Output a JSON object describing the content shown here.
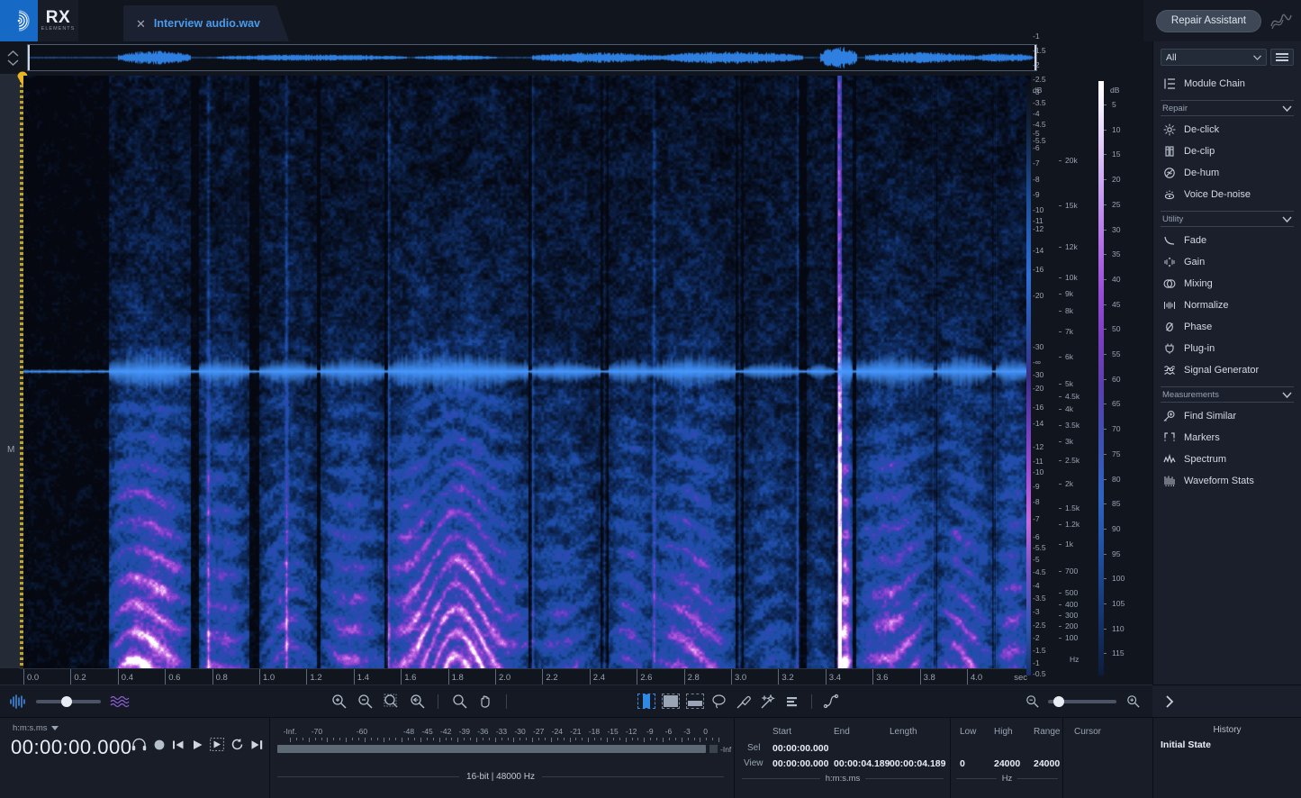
{
  "app": {
    "name": "RX",
    "edition": "ELEMENTS",
    "logo_icon": "izotope-waves-icon"
  },
  "titlebar": {
    "tab": {
      "close_icon": "close-icon",
      "label": "Interview audio.wav"
    },
    "repair_assistant_label": "Repair Assistant",
    "wave_mark_icon": "signature-wave-icon"
  },
  "overview": {
    "scroll_icon": "vertical-zoom-arrows-icon",
    "selection_handle_icon": "playhead-marker-icon"
  },
  "spectrogram": {
    "channel_label": "M",
    "time_ruler": {
      "unit": "sec",
      "ticks": [
        "0.0",
        "0.2",
        "0.4",
        "0.6",
        "0.8",
        "1.0",
        "1.2",
        "1.4",
        "1.6",
        "1.8",
        "2.0",
        "2.2",
        "2.4",
        "2.6",
        "2.8",
        "3.0",
        "3.2",
        "3.4",
        "3.6",
        "3.8",
        "4.0"
      ]
    },
    "amplitude_scale": {
      "title": "dB",
      "labels": [
        "-1",
        "-1.5",
        "-2",
        "-2.5",
        "-3",
        "-3.5",
        "-4",
        "-4.5",
        "-5",
        "-5.5",
        "-6",
        "-7",
        "-8",
        "-9",
        "-10",
        "-11",
        "-12",
        "-14",
        "-16",
        "-20",
        "-30",
        "-∞",
        "-30",
        "-20",
        "-16",
        "-14",
        "-12",
        "-11",
        "-10",
        "-9",
        "-8",
        "-7",
        "-6",
        "-5.5",
        "-5",
        "-4.5",
        "-4",
        "-3.5",
        "-3",
        "-2.5",
        "-2",
        "-1.5",
        "-1",
        "-0.5"
      ]
    },
    "frequency_scale": {
      "unit": "Hz",
      "labels": [
        "20k",
        "15k",
        "12k",
        "10k",
        "9k",
        "8k",
        "7k",
        "6k",
        "5k",
        "4.5k",
        "4k",
        "3.5k",
        "3k",
        "2.5k",
        "2k",
        "1.5k",
        "1.2k",
        "1k",
        "700",
        "500",
        "400",
        "300",
        "200",
        "100"
      ]
    },
    "colormap_scale": {
      "title": "dB",
      "labels": [
        "5",
        "10",
        "15",
        "20",
        "25",
        "30",
        "35",
        "40",
        "45",
        "50",
        "55",
        "60",
        "65",
        "70",
        "75",
        "80",
        "85",
        "90",
        "95",
        "100",
        "105",
        "110",
        "115"
      ]
    }
  },
  "toolbar": {
    "left": {
      "waveform_icon": "waveform-view-icon",
      "spectrogram_icon": "spectrogram-view-icon",
      "blend_slider_value": 50
    },
    "zoom_tools": [
      {
        "name": "zoom-in-tool",
        "icon": "magnifier-plus-icon"
      },
      {
        "name": "zoom-out-tool",
        "icon": "magnifier-minus-icon"
      },
      {
        "name": "zoom-to-selection-tool",
        "icon": "magnifier-selection-icon"
      },
      {
        "name": "zoom-fit-tool",
        "icon": "magnifier-fit-icon"
      },
      {
        "name": "magnify-tool",
        "icon": "magnifier-icon"
      },
      {
        "name": "hand-tool",
        "icon": "hand-icon"
      }
    ],
    "selection_tools": [
      {
        "name": "time-selection-tool",
        "icon": "time-selection-icon",
        "active": true
      },
      {
        "name": "time-frequency-selection-tool",
        "icon": "rectangle-selection-icon",
        "active": false
      },
      {
        "name": "frequency-selection-tool",
        "icon": "frequency-selection-icon",
        "active": false
      },
      {
        "name": "lasso-selection-tool",
        "icon": "lasso-icon",
        "active": false
      },
      {
        "name": "brush-selection-tool",
        "icon": "brush-icon",
        "active": false
      },
      {
        "name": "magic-wand-tool",
        "icon": "magic-wand-icon",
        "active": false
      },
      {
        "name": "harmonic-selection-tool",
        "icon": "harmonic-selection-icon",
        "active": false
      },
      {
        "name": "instant-process-tool",
        "icon": "pen-path-icon",
        "active": false
      }
    ],
    "right": {
      "zoom_out_icon": "magnifier-minus-icon",
      "zoom_in_icon": "magnifier-plus-icon",
      "horizontal_zoom_value": 8
    }
  },
  "modules": {
    "filter_value": "All",
    "menu_icon": "hamburger-menu-icon",
    "chain_item": {
      "label": "Module Chain",
      "icon": "module-chain-icon"
    },
    "groups": [
      {
        "title": "Repair",
        "chevron_icon": "chevron-down-icon",
        "items": [
          {
            "label": "De-click",
            "icon": "de-click-icon"
          },
          {
            "label": "De-clip",
            "icon": "de-clip-icon"
          },
          {
            "label": "De-hum",
            "icon": "de-hum-icon"
          },
          {
            "label": "Voice De-noise",
            "icon": "voice-de-noise-icon"
          }
        ]
      },
      {
        "title": "Utility",
        "chevron_icon": "chevron-down-icon",
        "items": [
          {
            "label": "Fade",
            "icon": "fade-icon"
          },
          {
            "label": "Gain",
            "icon": "gain-icon"
          },
          {
            "label": "Mixing",
            "icon": "mixing-icon"
          },
          {
            "label": "Normalize",
            "icon": "normalize-icon"
          },
          {
            "label": "Phase",
            "icon": "phase-icon"
          },
          {
            "label": "Plug-in",
            "icon": "plug-in-icon"
          },
          {
            "label": "Signal Generator",
            "icon": "signal-generator-icon"
          }
        ]
      },
      {
        "title": "Measurements",
        "chevron_icon": "chevron-down-icon",
        "items": [
          {
            "label": "Find Similar",
            "icon": "find-similar-icon"
          },
          {
            "label": "Markers",
            "icon": "markers-icon"
          },
          {
            "label": "Spectrum",
            "icon": "spectrum-icon"
          },
          {
            "label": "Waveform Stats",
            "icon": "waveform-stats-icon"
          }
        ]
      }
    ],
    "collapse_icon": "chevron-right-icon"
  },
  "transport": {
    "time_format": "h:m:s.ms",
    "format_chevron_icon": "chevron-down-small-icon",
    "timecode": "00:00:00.000",
    "buttons": [
      {
        "name": "monitor-button",
        "icon": "headphones-icon"
      },
      {
        "name": "record-button",
        "icon": "record-circle-icon"
      },
      {
        "name": "go-to-start-button",
        "icon": "skip-back-icon"
      },
      {
        "name": "play-button",
        "icon": "play-icon"
      },
      {
        "name": "play-selection-button",
        "icon": "play-selection-icon"
      },
      {
        "name": "loop-button",
        "icon": "loop-icon"
      },
      {
        "name": "go-to-end-button",
        "icon": "skip-forward-icon"
      }
    ]
  },
  "meter": {
    "labels": [
      "-Inf.",
      "-70",
      "-60",
      "-48",
      "-45",
      "-42",
      "-39",
      "-36",
      "-33",
      "-30",
      "-27",
      "-24",
      "-21",
      "-18",
      "-15",
      "-12",
      "-9",
      "-6",
      "-3",
      "0"
    ],
    "clip_label": "-Inf",
    "format_text": "16-bit | 48000 Hz"
  },
  "info": {
    "columns": [
      "Start",
      "End",
      "Length"
    ],
    "rows": [
      {
        "name": "Sel",
        "start": "00:00:00.000",
        "end": "",
        "length": ""
      },
      {
        "name": "View",
        "start": "00:00:00.000",
        "end": "00:00:04.189",
        "length": "00:00:04.189"
      }
    ],
    "unit": "h:m:s.ms",
    "freq_columns": [
      "Low",
      "High",
      "Range"
    ],
    "freq_values": [
      "0",
      "24000",
      "24000"
    ],
    "freq_unit": "Hz",
    "cursor_label": "Cursor",
    "cursor_value": ""
  },
  "history": {
    "title": "History",
    "items": [
      "Initial State"
    ]
  },
  "colors": {
    "accent_blue": "#1669c4",
    "tab_text": "#4a9bec",
    "panel_bg": "#1a1f2b",
    "app_bg": "#11151d",
    "spectro_magenta": "#b573e6",
    "spectro_blue": "#2f8ae6"
  }
}
